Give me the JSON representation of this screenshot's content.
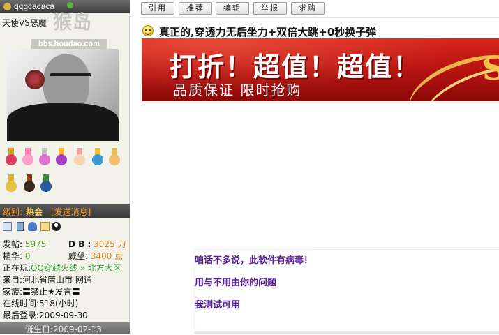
{
  "profile": {
    "username": "qqgcacaca",
    "nickname": "天使VS恶魔",
    "watermark_logo": "猴岛",
    "watermark_url": "bbs.houdao.com",
    "rank_label": "级别:",
    "rank_value": "热会",
    "send_message": "[发送消息]",
    "birthday": "诞生日:2009-02-13"
  },
  "stats": {
    "posts_label": "发帖:",
    "posts_value": "5975",
    "db_label": "D B :",
    "db_value": "3025 刀",
    "elite_label": "精华:",
    "elite_value": "0",
    "prestige_label": "威望:",
    "prestige_value": "3400 点",
    "playing_label": "正在玩:",
    "playing_value": "QQ穿越火线 » 北方大区",
    "from_label": "来自:",
    "from_value": "河北省唐山市 网通",
    "clan_label": "家族:",
    "clan_value": "〓禁止★发言〓",
    "online_label": "在线时间:",
    "online_value": "518(小时)",
    "last_login_label": "最后登录:",
    "last_login_value": "2009-09-30"
  },
  "toolbar": {
    "quote": "引用",
    "recommend": "推荐",
    "edit": "编辑",
    "report": "举报",
    "buy": "求购"
  },
  "post": {
    "title": "真正的,穿透力无后坐力+双倍大跳+0秒换子弹"
  },
  "banner": {
    "headline": "打折！超值！超值！",
    "subline": "品质保证 限时抢购",
    "letter": "S"
  },
  "reply": {
    "line1": "咱话不多说，此软件有病毒！",
    "line2": "用与不用由你的问题",
    "line3": "我测试可用"
  },
  "colors": {
    "accent_orange": "#ff9c1a",
    "reply_purple": "#5a2096",
    "banner_red": "#c4191a",
    "stat_green": "#57a02a"
  },
  "icons": {
    "medals": [
      "medal-icon",
      "medal-icon",
      "medal-icon",
      "medal-icon",
      "medal-icon",
      "medal-icon",
      "medal-icon",
      "medal-icon",
      "medal-icon",
      "medal-icon",
      "medal-icon"
    ],
    "actions": [
      "profile-card-icon",
      "phone-icon",
      "user-add-icon",
      "email-icon",
      "qq-icon"
    ]
  }
}
